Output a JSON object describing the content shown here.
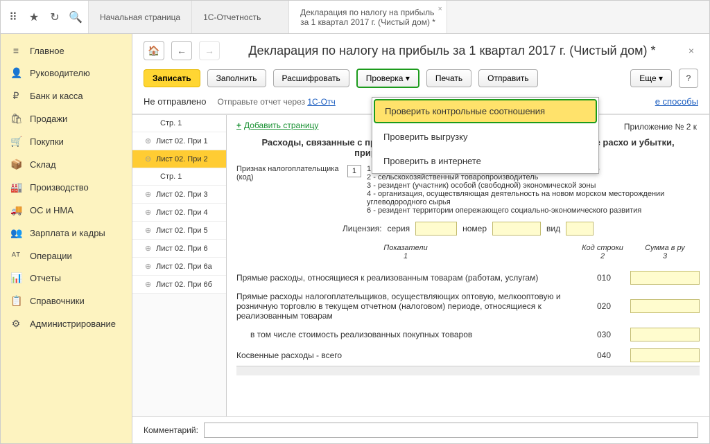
{
  "tabs": {
    "t0": "Начальная страница",
    "t1": "1С-Отчетность",
    "t2_line1": "Декларация по налогу на прибыль",
    "t2_line2": "за 1 квартал 2017 г. (Чистый дом) *"
  },
  "sidebar": {
    "items": [
      {
        "icon": "≡",
        "label": "Главное"
      },
      {
        "icon": "👤",
        "label": "Руководителю"
      },
      {
        "icon": "₽",
        "label": "Банк и касса"
      },
      {
        "icon": "🛍",
        "label": "Продажи"
      },
      {
        "icon": "🛒",
        "label": "Покупки"
      },
      {
        "icon": "📦",
        "label": "Склад"
      },
      {
        "icon": "🏭",
        "label": "Производство"
      },
      {
        "icon": "🚚",
        "label": "ОС и НМА"
      },
      {
        "icon": "👥",
        "label": "Зарплата и кадры"
      },
      {
        "icon": "ᴬᵀ",
        "label": "Операции"
      },
      {
        "icon": "📊",
        "label": "Отчеты"
      },
      {
        "icon": "📋",
        "label": "Справочники"
      },
      {
        "icon": "⚙",
        "label": "Администрирование"
      }
    ]
  },
  "doc": {
    "title": "Декларация по налогу на прибыль за 1 квартал 2017 г. (Чистый дом) *"
  },
  "toolbar": {
    "write": "Записать",
    "fill": "Заполнить",
    "decode": "Расшифровать",
    "check": "Проверка ▾",
    "print": "Печать",
    "send": "Отправить",
    "more": "Еще ▾",
    "help": "?"
  },
  "status": {
    "label": "Не отправлено",
    "hint_prefix": "Отправьте отчет через ",
    "hint_link": "1С-Отч",
    "other": "е способы"
  },
  "dropdown": {
    "i0": "Проверить контрольные соотношения",
    "i1": "Проверить выгрузку",
    "i2": "Проверить в интернете"
  },
  "tree": {
    "p1a": "Стр. 1",
    "l1": "Лист 02. При 1",
    "l2": "Лист 02. При 2",
    "p1b": "Стр. 1",
    "l3": "Лист 02. При 3",
    "l4": "Лист 02. При 4",
    "l5": "Лист 02. При 5",
    "l6": "Лист 02. При 6",
    "l6a": "Лист 02. При 6а",
    "l6b": "Лист 02. При 6б"
  },
  "form": {
    "add_page": "Добавить страницу",
    "appendix": "Приложение № 2 к",
    "section_title": "Расходы, связанные с производством и реализацией, внереализационные расхо и убытки, приравниваемые к внереализационным расходам",
    "taxpayer_label": "Признак налогоплательщика (код)",
    "taxpayer_code": "1",
    "codes": {
      "c1": "1 - организация, не относящаяся к указанным по кодам 2, 3, 4 и 6",
      "c2": "2 - сельскохозяйственный товаропроизводитель",
      "c3": "3 - резидент (участник) особой (свободной) экономической зоны",
      "c4": "4 - организация, осуществляющая деятельность на новом морском месторождении углеводородного сырья",
      "c6": "6 - резидент территории опережающего социально-экономического развития"
    },
    "license": {
      "label": "Лицензия:",
      "series": "серия",
      "number": "номер",
      "type": "вид"
    },
    "cols": {
      "c1a": "Показатели",
      "c1b": "1",
      "c2a": "Код строки",
      "c2b": "2",
      "c3a": "Сумма в ру",
      "c3b": "3"
    },
    "rows": [
      {
        "label": "Прямые расходы, относящиеся к реализованным товарам (работам, услугам)",
        "code": "010"
      },
      {
        "label": "Прямые расходы налогоплательщиков, осуществляющих оптовую, мелкооптовую и розничную торговлю в текущем отчетном (налоговом) периоде, относящиеся к реализованным товарам",
        "code": "020"
      },
      {
        "label": "   в том числе стоимость реализованных покупных товаров",
        "code": "030"
      },
      {
        "label": "Косвенные расходы - всего",
        "code": "040"
      }
    ]
  },
  "comment": {
    "label": "Комментарий:"
  }
}
